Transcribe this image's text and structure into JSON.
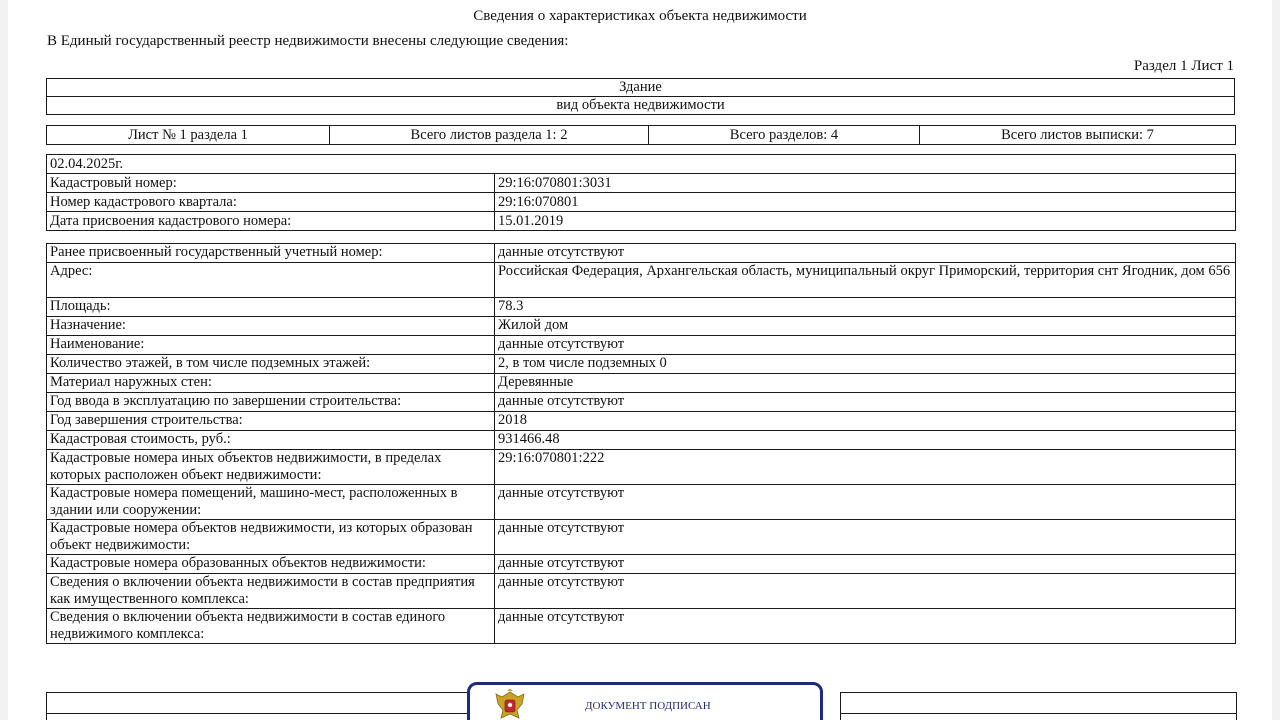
{
  "document": {
    "title": "Сведения о характеристиках объекта недвижимости",
    "intro": "В Единый государственный реестр недвижимости внесены следующие сведения:",
    "section_ref": "Раздел 1 Лист 1"
  },
  "object_kind": {
    "value": "Здание",
    "caption": "вид объекта недвижимости"
  },
  "sheets": [
    "Лист № 1 раздела 1",
    "Всего листов раздела 1: 2",
    "Всего разделов: 4",
    "Всего листов выписки: 7"
  ],
  "identification": {
    "date": "02.04.2025г.",
    "rows": [
      {
        "label": "Кадастровый номер:",
        "value": "29:16:070801:3031"
      },
      {
        "label": "Номер кадастрового квартала:",
        "value": "29:16:070801"
      },
      {
        "label": "Дата присвоения кадастрового номера:",
        "value": "15.01.2019"
      }
    ]
  },
  "characteristics": [
    {
      "label": "Ранее присвоенный государственный учетный номер:",
      "value": "данные отсутствуют"
    },
    {
      "label": "Адрес:",
      "value": "Российская Федерация, Архангельская область, муниципальный округ Приморский, территория снт Ягодник, дом 656"
    },
    {
      "label": "Площадь:",
      "value": "78.3"
    },
    {
      "label": "Назначение:",
      "value": "Жилой дом"
    },
    {
      "label": "Наименование:",
      "value": "данные отсутствуют"
    },
    {
      "label": "Количество этажей, в том числе подземных этажей:",
      "value": "2, в том числе подземных 0"
    },
    {
      "label": "Материал наружных стен:",
      "value": "Деревянные"
    },
    {
      "label": "Год ввода в эксплуатацию по завершении строительства:",
      "value": "данные отсутствуют"
    },
    {
      "label": "Год завершения строительства:",
      "value": "2018"
    },
    {
      "label": "Кадастровая стоимость, руб.:",
      "value": "931466.48"
    },
    {
      "label": "Кадастровые номера иных объектов недвижимости, в пределах которых расположен объект недвижимости:",
      "value": "29:16:070801:222"
    },
    {
      "label": "Кадастровые номера помещений, машино-мест, расположенных в здании или сооружении:",
      "value": "данные отсутствуют"
    },
    {
      "label": "Кадастровые номера объектов недвижимости, из которых образован объект недвижимости:",
      "value": "данные отсутствуют"
    },
    {
      "label": "Кадастровые номера образованных объектов недвижимости:",
      "value": "данные отсутствуют"
    },
    {
      "label": "Сведения о включении объекта недвижимости в состав предприятия как имущественного комплекса:",
      "value": "данные отсутствуют"
    },
    {
      "label": "Сведения о включении объекта недвижимости в состав единого недвижимого комплекса:",
      "value": "данные отсутствуют"
    }
  ],
  "signature_stamp": {
    "label": "ДОКУМЕНТ ПОДПИСАН",
    "emblem_icon": "coat-of-arms-icon",
    "color": "#1f2a78"
  }
}
